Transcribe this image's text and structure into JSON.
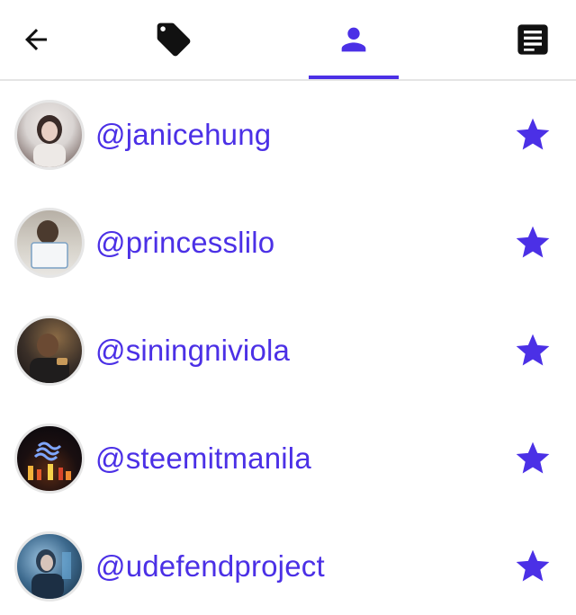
{
  "nav": {
    "tabs": [
      {
        "id": "back",
        "icon": "arrow-left-icon"
      },
      {
        "id": "tags",
        "icon": "tag-icon"
      },
      {
        "id": "users",
        "icon": "user-icon",
        "active": true
      },
      {
        "id": "posts",
        "icon": "document-icon"
      }
    ],
    "accent": "#4b30e6"
  },
  "users": [
    {
      "username": "@janicehung",
      "icon": "star-icon",
      "avatar_colors": [
        "#d9d4d2",
        "#3a2b28"
      ]
    },
    {
      "username": "@princesslilo",
      "icon": "star-icon",
      "avatar_colors": [
        "#c7c2b6",
        "#4b3a2e"
      ]
    },
    {
      "username": "@siningniviola",
      "icon": "star-icon",
      "avatar_colors": [
        "#2c2a2a",
        "#b58a52"
      ]
    },
    {
      "username": "@steemitmanila",
      "icon": "star-icon",
      "avatar_colors": [
        "#0b0b14",
        "#d8652a"
      ]
    },
    {
      "username": "@udefendproject",
      "icon": "star-icon",
      "avatar_colors": [
        "#1d3f5b",
        "#8ab4d4"
      ]
    }
  ],
  "colors": {
    "accent": "#4b30e6",
    "divider": "#e4e4e4",
    "dark_icon": "#111111"
  }
}
